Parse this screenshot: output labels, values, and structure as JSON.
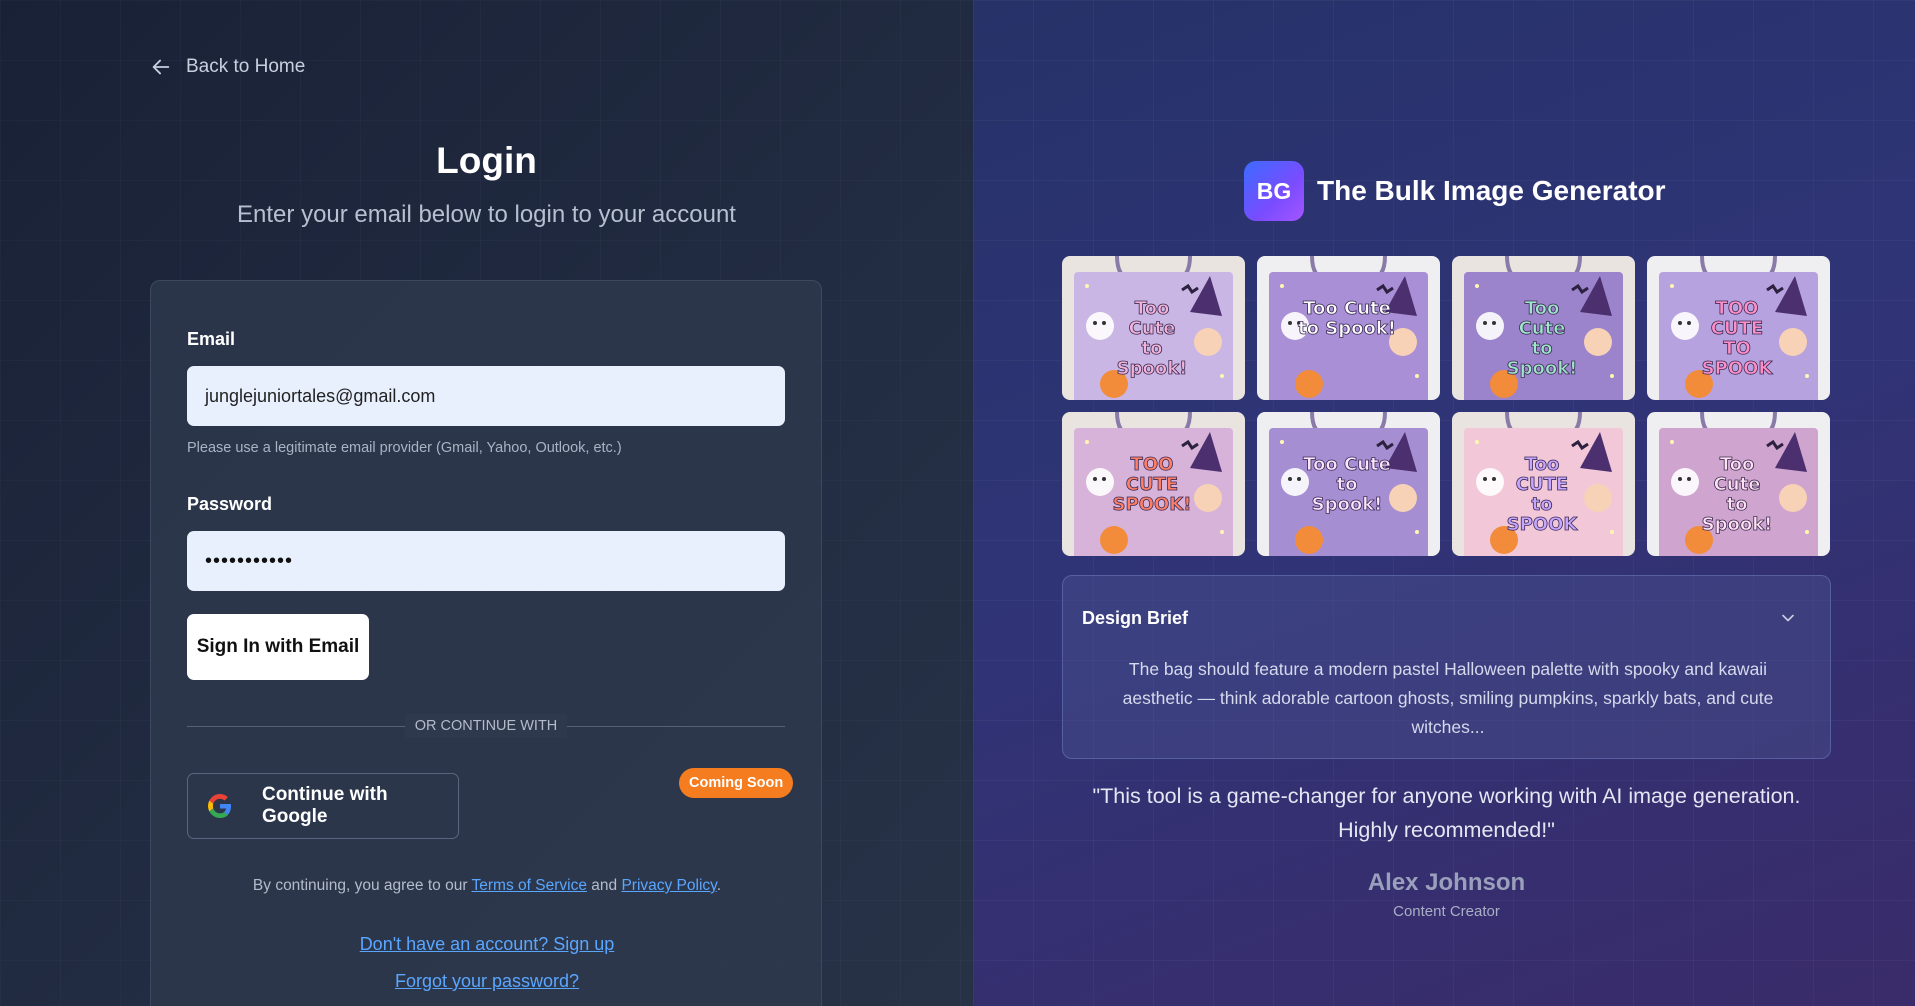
{
  "nav": {
    "back_label": "Back to Home"
  },
  "login": {
    "title": "Login",
    "subtitle": "Enter your email below to login to your account",
    "email_label": "Email",
    "email_value": "junglejuniortales@gmail.com",
    "email_hint": "Please use a legitimate email provider (Gmail, Yahoo, Outlook, etc.)",
    "password_label": "Password",
    "password_value": "•••••••••••",
    "signin_label": "Sign In with Email",
    "divider_label": "OR CONTINUE WITH",
    "google_label": "Continue with Google",
    "coming_soon_badge": "Coming Soon",
    "terms_prefix": "By continuing, you agree to our",
    "terms_link": "Terms of Service",
    "terms_and": "and",
    "privacy_link": "Privacy Policy",
    "terms_suffix": ".",
    "signup_link": "Don't have an account? Sign up",
    "forgot_link": "Forgot your password?"
  },
  "brand": {
    "logo_text": "BG",
    "name": "The Bulk Image Generator"
  },
  "gallery": {
    "tiles": [
      {
        "line1": "Too",
        "line2": "Cute",
        "line3": "to",
        "line4": "Spook!",
        "bg": "#c9b6e4",
        "text_color": "#f3b3d6"
      },
      {
        "line1": "Too Cute",
        "line2": "to Spook!",
        "line3": "",
        "line4": "",
        "bg": "#a98fd6",
        "text_color": "#ffffff"
      },
      {
        "line1": "Too",
        "line2": "Cute",
        "line3": "to",
        "line4": "Spook!",
        "bg": "#9c84cc",
        "text_color": "#9ee6c9"
      },
      {
        "line1": "TOO",
        "line2": "CUTE",
        "line3": "TO",
        "line4": "SPOOK",
        "bg": "#b7a2e0",
        "text_color": "#ff8fc7"
      },
      {
        "line1": "TOO",
        "line2": "CUTE",
        "line3": "SPOOK!",
        "line4": "",
        "bg": "#d7b3d9",
        "text_color": "#ff7f66"
      },
      {
        "line1": "Too Cute",
        "line2": "to",
        "line3": "Spook!",
        "line4": "",
        "bg": "#a58fd2",
        "text_color": "#fce6ff"
      },
      {
        "line1": "Too",
        "line2": "CUTE",
        "line3": "to",
        "line4": "SPOOK",
        "bg": "#f2c7d8",
        "text_color": "#c7a6ff"
      },
      {
        "line1": "Too",
        "line2": "Cute",
        "line3": "to",
        "line4": "Spook!",
        "bg": "#cfa4cf",
        "text_color": "#ffe3f1"
      }
    ]
  },
  "brief": {
    "title": "Design Brief",
    "text": "The bag should feature a modern pastel Halloween palette with spooky and kawaii aesthetic — think adorable cartoon ghosts, smiling pumpkins, sparkly bats, and cute witches..."
  },
  "testimonial": {
    "quote": "\"This tool is a game-changer for anyone working with AI image generation. Highly recommended!\"",
    "author": "Alex Johnson",
    "role": "Content Creator"
  },
  "colors": {
    "accent_link": "#5aa6ff",
    "badge_orange": "#f57c1f",
    "brand_gradient_start": "#3b6bff",
    "brand_gradient_end": "#a455ff"
  }
}
